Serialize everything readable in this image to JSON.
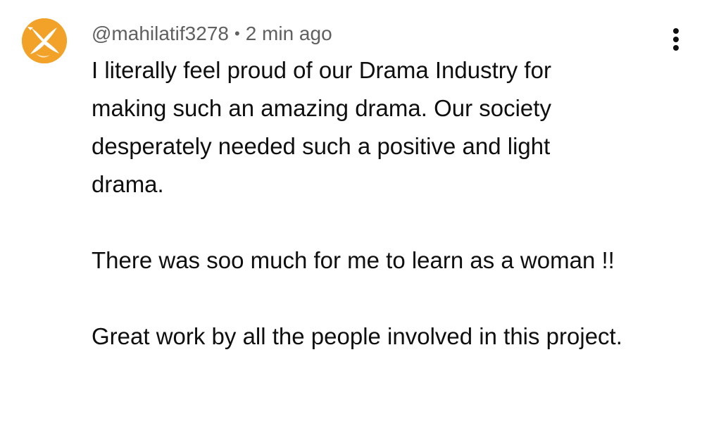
{
  "comment": {
    "author": "@mahilatif3278",
    "separator": "•",
    "time": "2 min ago",
    "avatar_icon": "dove-icon",
    "menu_icon": "more-vert-icon",
    "paragraphs": [
      "I literally feel proud of our Drama Industry for making such an amazing drama. Our society desperately needed such a positive and light drama.",
      "There was soo much for me to learn as a woman !!",
      "Great work by all the people involved in this project."
    ]
  },
  "colors": {
    "avatar_bg": "#f2a228",
    "meta_text": "#606060",
    "body_text": "#0f0f0f"
  }
}
